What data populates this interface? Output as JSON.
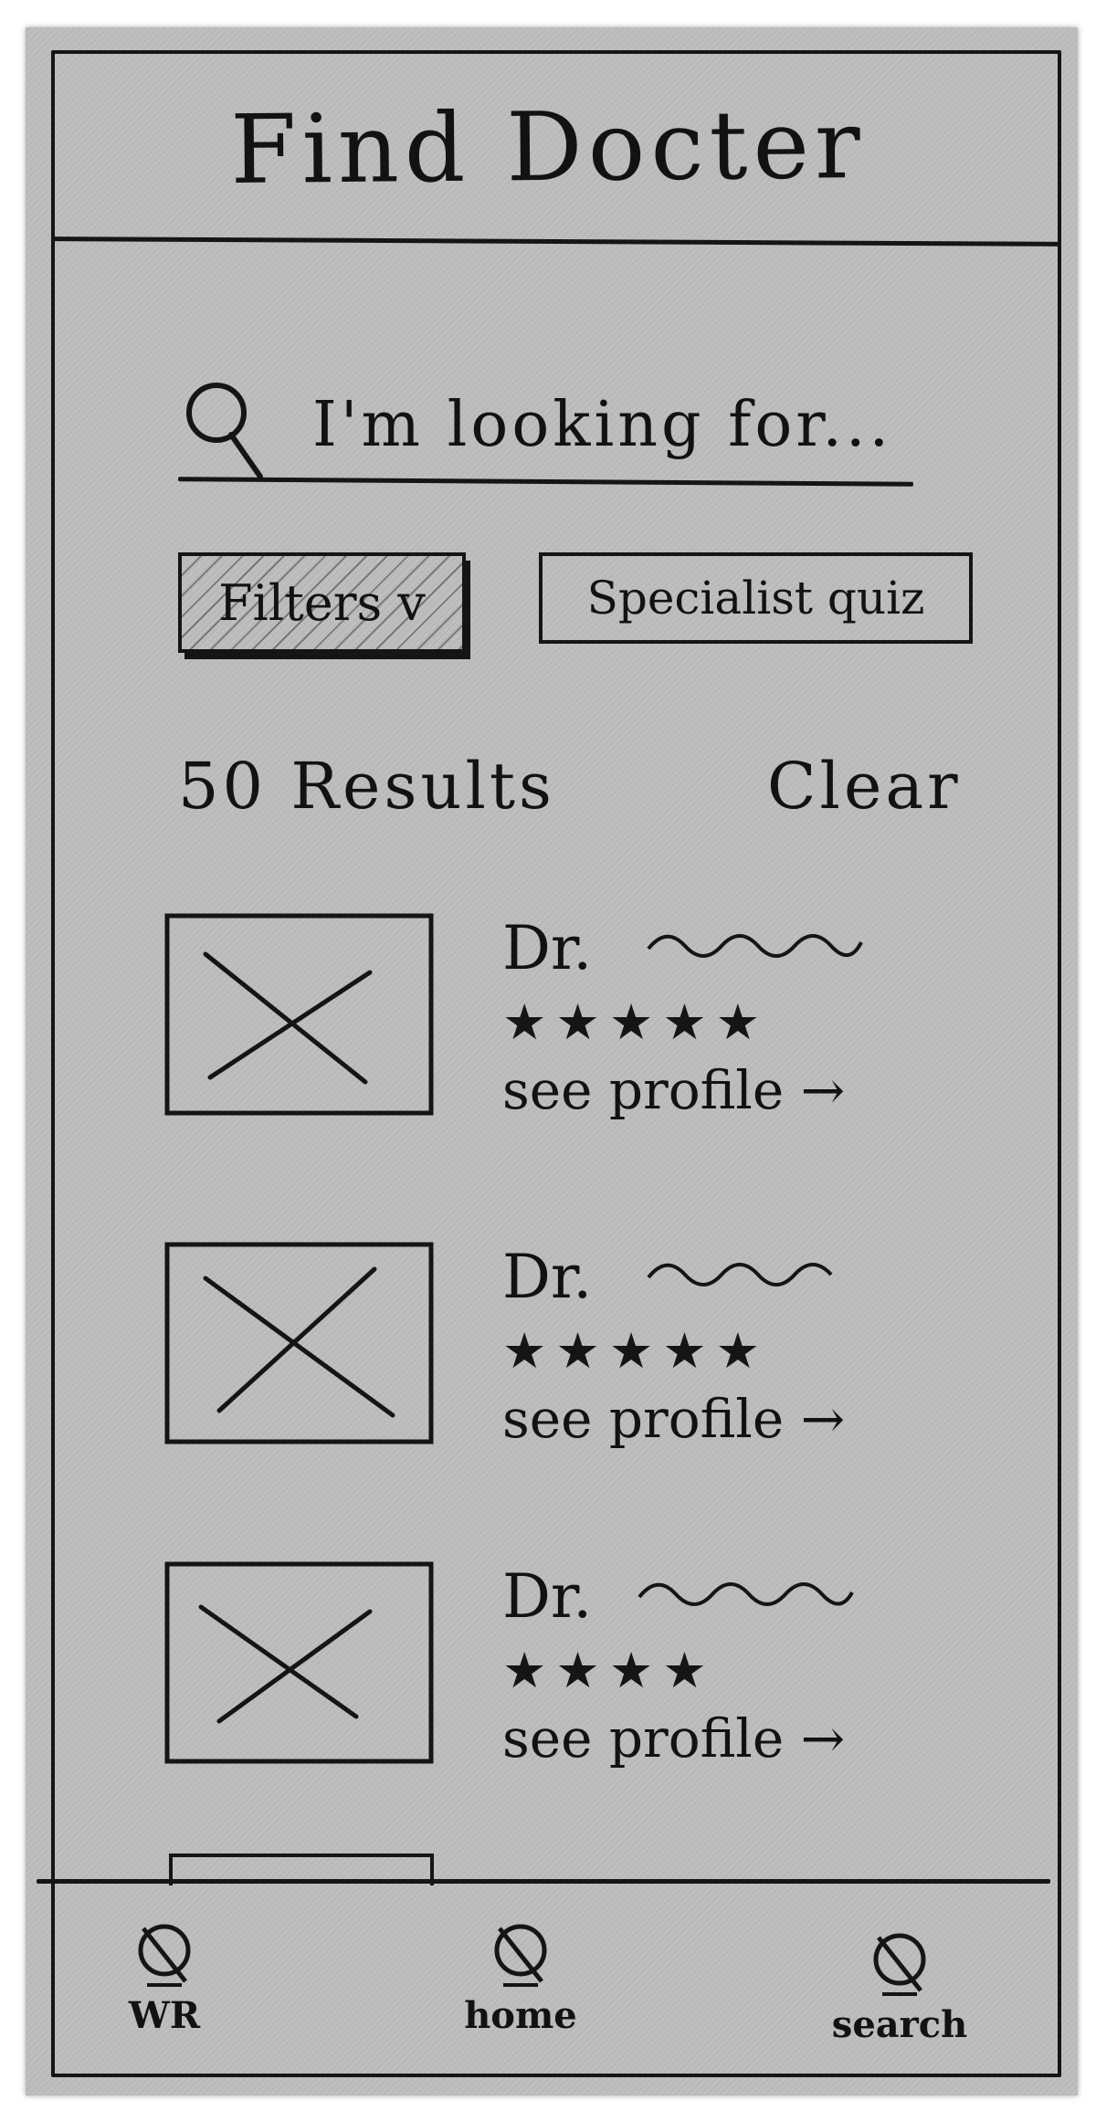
{
  "header": {
    "title": "Find Docter"
  },
  "search": {
    "placeholder": "I'm looking for..."
  },
  "buttons": {
    "filters": "Filters v",
    "specialist_quiz": "Specialist quiz"
  },
  "results": {
    "count_label": "50 Results",
    "clear_label": "Clear"
  },
  "doctors": [
    {
      "name": "Dr.",
      "rating": 5,
      "stars": "★★★★★",
      "link": "see profile →"
    },
    {
      "name": "Dr.",
      "rating": 5,
      "stars": "★★★★★",
      "link": "see profile →"
    },
    {
      "name": "Dr.",
      "rating": 4,
      "stars": "★★★★",
      "link": "see profile →"
    }
  ],
  "nav": {
    "items": [
      {
        "label": "WR",
        "icon": "nav-icon"
      },
      {
        "label": "home",
        "icon": "nav-icon"
      },
      {
        "label": "search",
        "icon": "nav-icon"
      }
    ]
  },
  "colors": {
    "paper": "#bdbdbd",
    "ink": "#151515"
  }
}
